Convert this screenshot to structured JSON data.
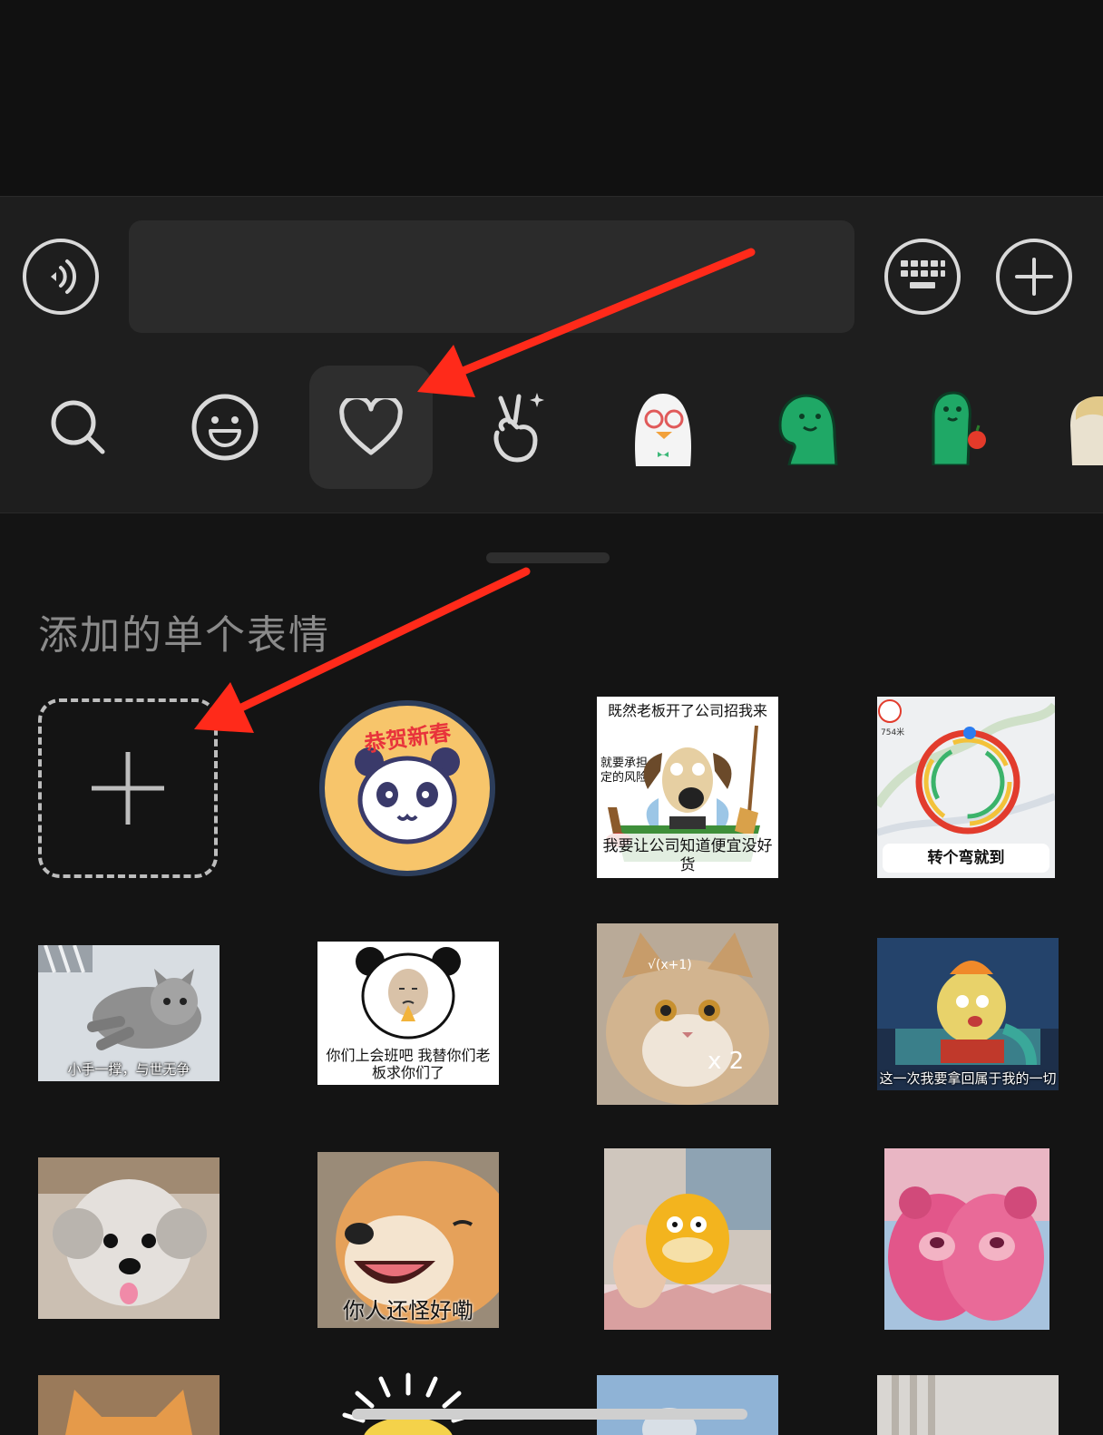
{
  "toolbar": {
    "voice_icon": "voice-icon",
    "keyboard_icon": "keyboard-icon",
    "add_icon": "plus-circle-icon",
    "message_input": {
      "value": "",
      "placeholder": ""
    }
  },
  "tabs": [
    {
      "name": "search",
      "icon": "search-icon"
    },
    {
      "name": "emoji",
      "icon": "smile-icon"
    },
    {
      "name": "favorites",
      "icon": "heart-icon",
      "active": true
    },
    {
      "name": "gesture",
      "icon": "peace-hand-icon"
    },
    {
      "name": "sticker-pack-duck",
      "icon": "duck-sticker-icon"
    },
    {
      "name": "sticker-pack-dino",
      "icon": "green-dino-icon"
    },
    {
      "name": "sticker-pack-dino-apple",
      "icon": "green-dino-apple-icon"
    },
    {
      "name": "sticker-pack-more",
      "icon": "partial-sticker-icon"
    }
  ],
  "section": {
    "title": "添加的单个表情"
  },
  "stickers": [
    {
      "caption": "恭贺新春"
    },
    {
      "top": "既然老板开了公司招我来",
      "mid": "就要承担一定的风险",
      "caption": "我要让公司知道便宜没好货"
    },
    {
      "caption": "转个弯就到",
      "map_label": "754米"
    },
    {
      "caption": "小手一撑，与世无争"
    },
    {
      "caption": "你们上会班吧 我替你们老板求你们了"
    },
    {
      "caption": ""
    },
    {
      "caption": "这一次我要拿回属于我的一切"
    },
    {
      "caption": ""
    },
    {
      "caption": "你人还怪好嘞"
    },
    {
      "caption": ""
    },
    {
      "caption": ""
    }
  ],
  "colors": {
    "background": "#141414",
    "panel": "#1e1e1e",
    "arrow": "#ff2a1a",
    "active_tab": "#2e2e2e"
  }
}
